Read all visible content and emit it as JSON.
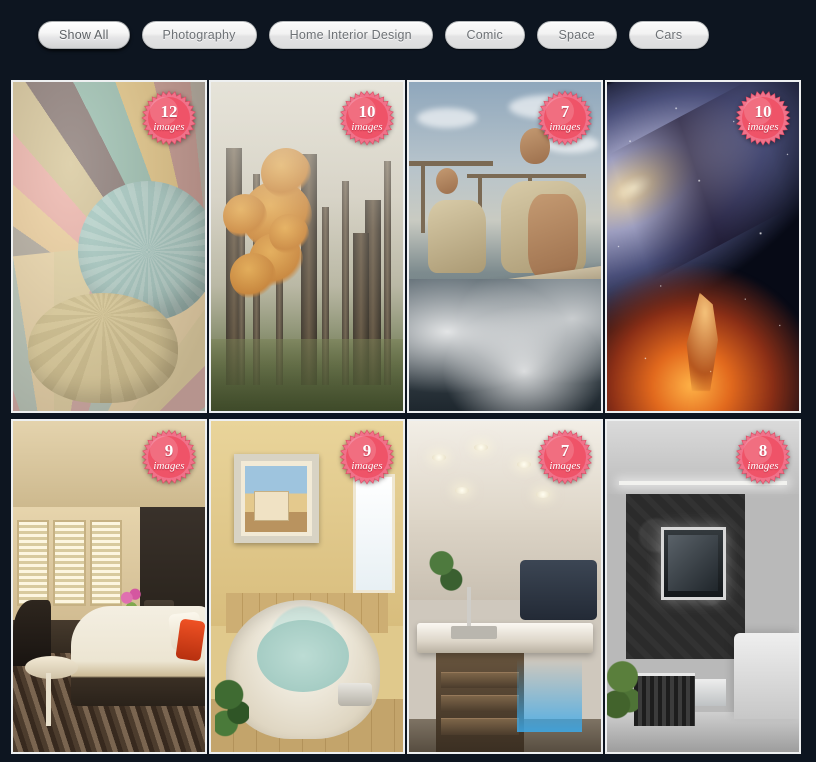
{
  "page": {
    "background_color": "#0d1520",
    "badge_color": "#ef5a6e",
    "card_border_color": "#eef0f1"
  },
  "filters": {
    "items": [
      {
        "label": "Show All",
        "active": true
      },
      {
        "label": "Photography",
        "active": false
      },
      {
        "label": "Home Interior Design",
        "active": false
      },
      {
        "label": "Comic",
        "active": false
      },
      {
        "label": "Space",
        "active": false
      },
      {
        "label": "Cars",
        "active": false
      }
    ]
  },
  "gallery": {
    "badge_label": "images",
    "cards": [
      {
        "count": "12",
        "badge_label": "images",
        "scene": "hot-air-balloons",
        "alt": "Colorful hot air balloon panels and parasol"
      },
      {
        "count": "10",
        "badge_label": "images",
        "scene": "autumn-forest",
        "alt": "Misty autumn forest with orange maple leaves"
      },
      {
        "count": "7",
        "badge_label": "images",
        "scene": "men-in-boat",
        "alt": "Two men riding a wooden boat through whitewater"
      },
      {
        "count": "10",
        "badge_label": "images",
        "scene": "galaxy-nebula",
        "alt": "Spiral galaxy and orange nebula in deep space"
      },
      {
        "count": "9",
        "badge_label": "images",
        "scene": "hotel-bedroom",
        "alt": "Warm hotel bedroom with shutters and red pillow"
      },
      {
        "count": "9",
        "badge_label": "images",
        "scene": "bathroom-tub",
        "alt": "Yellow bathroom with corner soaking tub and framed art"
      },
      {
        "count": "7",
        "badge_label": "images",
        "scene": "modern-kitchen",
        "alt": "Modern kitchen island with blue under-cabinet lighting"
      },
      {
        "count": "8",
        "badge_label": "images",
        "scene": "living-room-tv",
        "alt": "Grey living room with wall mounted TV and white sofa"
      }
    ]
  }
}
